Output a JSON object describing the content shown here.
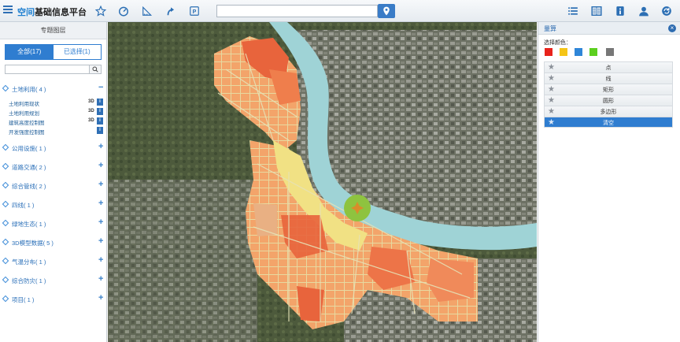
{
  "header": {
    "title_highlight": "空间",
    "title_rest": "基础信息平台",
    "search_placeholder": "",
    "tools": [
      "star-icon",
      "dashboard-icon",
      "measure-icon",
      "arrow-up-icon",
      "parking-icon"
    ],
    "right_tools": [
      "list-icon",
      "columns-icon",
      "info-icon",
      "user-icon",
      "refresh-icon"
    ]
  },
  "left": {
    "title": "专题图层",
    "tab_all": "全部(17)",
    "tab_selected": "已选择(1)",
    "search_placeholder": "",
    "categories": [
      {
        "label": "土地利用( 4 )",
        "toggle": "−"
      },
      {
        "label": "公用设施( 1 )",
        "toggle": "+"
      },
      {
        "label": "道路交通( 2 )",
        "toggle": "+"
      },
      {
        "label": "综合管线( 2 )",
        "toggle": "+"
      },
      {
        "label": "四线( 1 )",
        "toggle": "+"
      },
      {
        "label": "绿地生态( 1 )",
        "toggle": "+"
      },
      {
        "label": "3D模型数据( 5 )",
        "toggle": "+"
      },
      {
        "label": "气温分布( 1 )",
        "toggle": "+"
      },
      {
        "label": "综合防灾( 1 )",
        "toggle": "+"
      },
      {
        "label": "项目( 1 )",
        "toggle": "+"
      }
    ],
    "sublayers": [
      {
        "label": "土地利用现状",
        "badge": "3D"
      },
      {
        "label": "土地利用规划",
        "badge": "3D"
      },
      {
        "label": "建筑高度控制图",
        "badge": "3D"
      },
      {
        "label": "开发强度控制图",
        "badge": ""
      }
    ],
    "info_glyph": "i"
  },
  "right": {
    "title": "量算",
    "close_glyph": "×",
    "color_label": "选择颜色：",
    "colors": [
      "#e8231c",
      "#f5c518",
      "#2f86d8",
      "#5ccf1f",
      "#777777"
    ],
    "tools": [
      {
        "label": "点",
        "active": false
      },
      {
        "label": "线",
        "active": false
      },
      {
        "label": "矩形",
        "active": false
      },
      {
        "label": "圆形",
        "active": false
      },
      {
        "label": "多边形",
        "active": false
      },
      {
        "label": "清空",
        "active": true
      }
    ]
  }
}
